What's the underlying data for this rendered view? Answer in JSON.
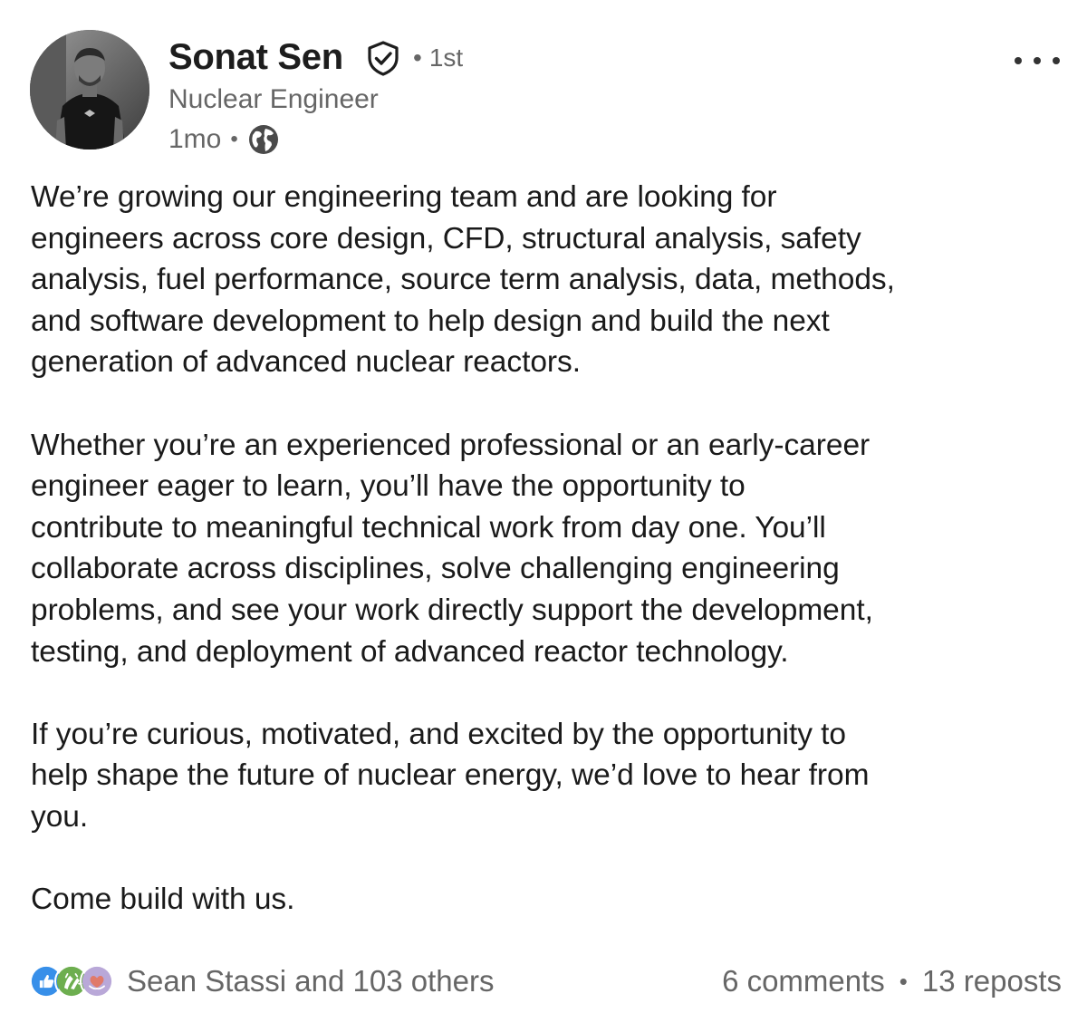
{
  "author": {
    "name": "Sonat Sen",
    "degree": "1st",
    "degree_separator": "•",
    "headline": "Nuclear Engineer",
    "timestamp": "1mo",
    "timestamp_separator": "•",
    "visibility_icon": "globe-icon",
    "verified_icon": "verified-shield-icon"
  },
  "menu": {
    "icon": "more-options-icon"
  },
  "post": {
    "paragraphs": [
      "We’re growing our engineering team and are looking for\nengineers across core design, CFD, structural analysis, safety\nanalysis, fuel performance, source term analysis, data, methods,\nand software development to help design and build the next\ngeneration of advanced nuclear reactors.",
      "Whether you’re an experienced professional or an early-career\nengineer eager to learn, you’ll have the opportunity to\ncontribute to meaningful technical work from day one. You’ll\ncollaborate across disciplines, solve challenging engineering\nproblems, and see your work directly support the development,\ntesting, and deployment of advanced reactor technology.",
      "If you’re curious, motivated, and excited by the opportunity to\nhelp shape the future of nuclear energy, we’d love to hear from\nyou.",
      "Come build with us."
    ]
  },
  "social": {
    "reaction_icons": [
      "like-icon",
      "celebrate-icon",
      "love-icon"
    ],
    "reactors_text": "Sean Stassi and 103 others",
    "comments": "6 comments",
    "separator": "•",
    "reposts": "13 reposts"
  },
  "colors": {
    "like": "#378fe9",
    "celebrate": "#5f9b41",
    "love": "#d98a7a",
    "secondary_text": "#666666"
  }
}
